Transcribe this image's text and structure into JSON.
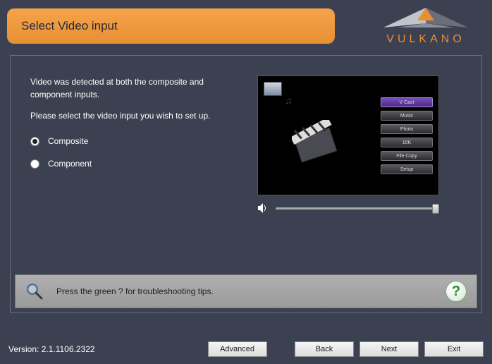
{
  "header": {
    "title": "Select Video input",
    "brand": "VULKANO"
  },
  "instructions": {
    "line1": "Video was detected at both the composite and component inputs.",
    "line2": "Please select the video input you wish to set up."
  },
  "options": {
    "composite": "Composite",
    "component": "Component",
    "selected": "composite"
  },
  "preview_menu": {
    "items": [
      "V Cast",
      "Music",
      "Photo",
      "10K",
      "File Copy",
      "Setup"
    ],
    "active_index": 0
  },
  "tip": {
    "text": "Press the green ? for troubleshooting tips.",
    "help_symbol": "?"
  },
  "footer": {
    "version_label": "Version: 2.1.1106.2322",
    "advanced": "Advanced",
    "back": "Back",
    "next": "Next",
    "exit": "Exit"
  }
}
